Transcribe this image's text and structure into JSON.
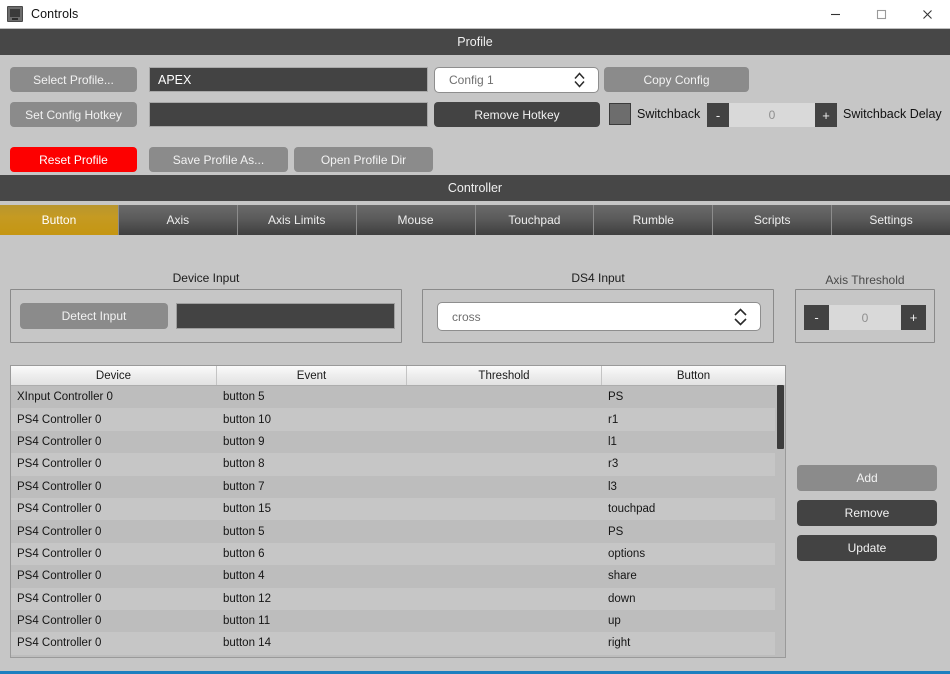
{
  "window": {
    "title": "Controls",
    "icon": "controller-icon",
    "minimize_label": "—",
    "maximize_label": "□",
    "close_label": "✕",
    "accent_border": "#1d7fc0"
  },
  "profile_section": {
    "header": "Profile",
    "select_profile_button": "Select Profile...",
    "profile_name_value": "APEX",
    "config_select_value": "Config 1",
    "copy_config_button": "Copy Config",
    "set_config_hotkey_button": "Set Config Hotkey",
    "hotkey_value": "",
    "remove_hotkey_button": "Remove Hotkey",
    "switchback_label": "Switchback",
    "switchback_checked": false,
    "switchback_delay_minus": "-",
    "switchback_delay_value": "0",
    "switchback_delay_plus": "+",
    "switchback_delay_label": "Switchback Delay",
    "reset_profile_button": "Reset Profile",
    "save_profile_as_button": "Save Profile As...",
    "open_profile_dir_button": "Open Profile Dir",
    "reset_color": "#fd0000"
  },
  "controller_section": {
    "header": "Controller",
    "tabs": [
      {
        "label": "Button",
        "active": true
      },
      {
        "label": "Axis",
        "active": false
      },
      {
        "label": "Axis Limits",
        "active": false
      },
      {
        "label": "Mouse",
        "active": false
      },
      {
        "label": "Touchpad",
        "active": false
      },
      {
        "label": "Rumble",
        "active": false
      },
      {
        "label": "Scripts",
        "active": false
      },
      {
        "label": "Settings",
        "active": false
      }
    ],
    "active_tab_color": "#c59612"
  },
  "device_input": {
    "label": "Device Input",
    "detect_button": "Detect Input",
    "value": ""
  },
  "ds4_input": {
    "label": "DS4 Input",
    "selected": "cross"
  },
  "axis_threshold": {
    "label": "Axis Threshold",
    "minus": "-",
    "value": "0",
    "plus": "+"
  },
  "bindings_table": {
    "columns": [
      "Device",
      "Event",
      "Threshold",
      "Button"
    ],
    "rows": [
      {
        "device": "XInput Controller 0",
        "event": "button 5",
        "threshold": "",
        "button": "PS"
      },
      {
        "device": "PS4 Controller 0",
        "event": "button 10",
        "threshold": "",
        "button": "r1"
      },
      {
        "device": "PS4 Controller 0",
        "event": "button 9",
        "threshold": "",
        "button": "l1"
      },
      {
        "device": "PS4 Controller 0",
        "event": "button 8",
        "threshold": "",
        "button": "r3"
      },
      {
        "device": "PS4 Controller 0",
        "event": "button 7",
        "threshold": "",
        "button": "l3"
      },
      {
        "device": "PS4 Controller 0",
        "event": "button 15",
        "threshold": "",
        "button": "touchpad"
      },
      {
        "device": "PS4 Controller 0",
        "event": "button 5",
        "threshold": "",
        "button": "PS"
      },
      {
        "device": "PS4 Controller 0",
        "event": "button 6",
        "threshold": "",
        "button": "options"
      },
      {
        "device": "PS4 Controller 0",
        "event": "button 4",
        "threshold": "",
        "button": "share"
      },
      {
        "device": "PS4 Controller 0",
        "event": "button 12",
        "threshold": "",
        "button": "down"
      },
      {
        "device": "PS4 Controller 0",
        "event": "button 11",
        "threshold": "",
        "button": "up"
      },
      {
        "device": "PS4 Controller 0",
        "event": "button 14",
        "threshold": "",
        "button": "right"
      }
    ]
  },
  "row_actions": {
    "add_button": "Add",
    "remove_button": "Remove",
    "update_button": "Update"
  }
}
